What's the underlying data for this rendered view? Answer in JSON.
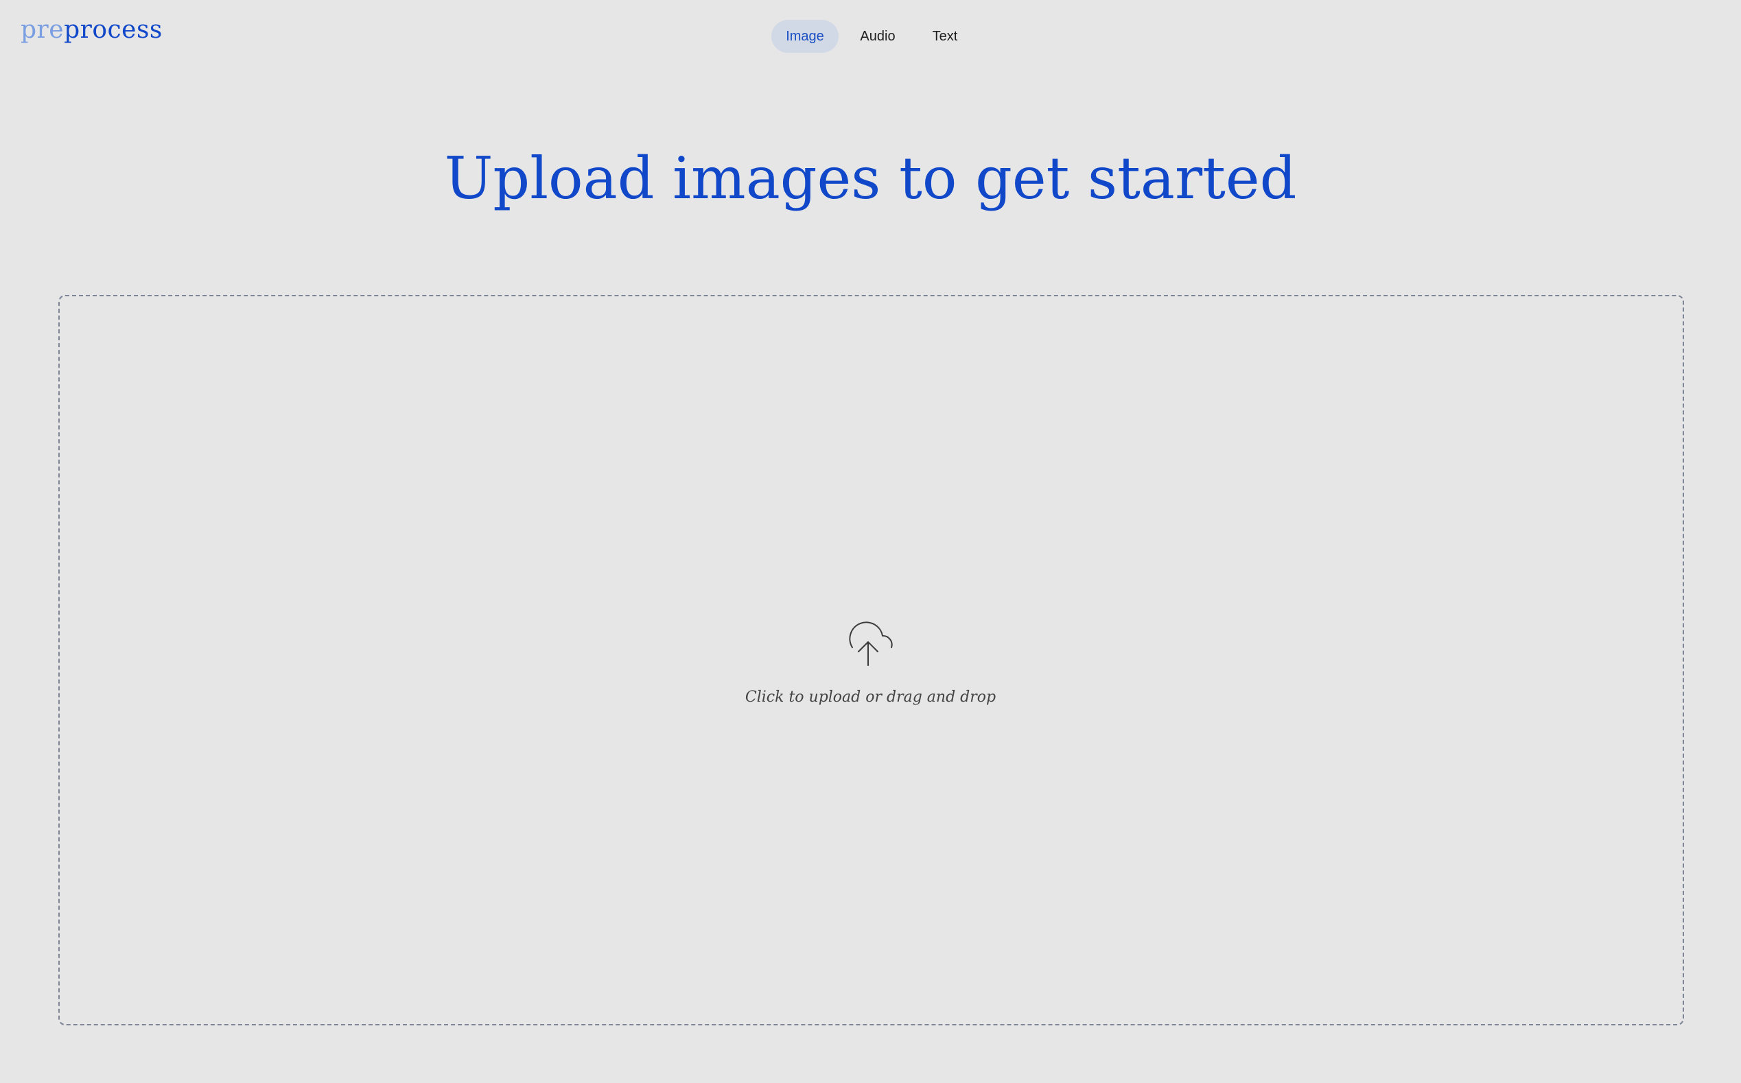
{
  "brand": {
    "prefix": "pre",
    "suffix": "process",
    "prefix_color": "#7a9ee2",
    "suffix_color": "#1148c9"
  },
  "nav": {
    "tabs": [
      {
        "label": "Image",
        "active": true
      },
      {
        "label": "Audio",
        "active": false
      },
      {
        "label": "Text",
        "active": false
      }
    ]
  },
  "main": {
    "title": "Upload images to get started",
    "dropzone": {
      "icon": "cloud-upload-icon",
      "label": "Click to upload or drag and drop"
    }
  },
  "colors": {
    "accent": "#1148c9",
    "background": "#e6e6e6",
    "active_tab_bg": "#d1d8e6",
    "dropzone_border": "#7e8597"
  }
}
